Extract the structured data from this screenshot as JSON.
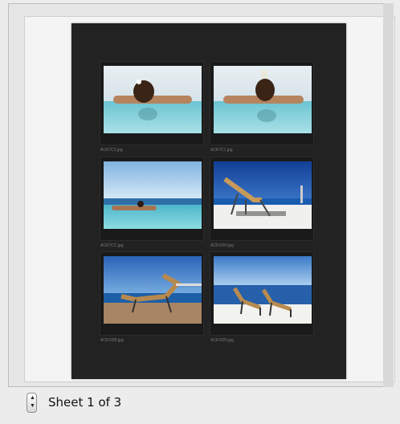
{
  "pager": {
    "label": "Sheet 1 of 3"
  },
  "thumbnails": [
    {
      "filename": "ACK7C2.jpg",
      "subject": "woman-in-infinity-pool"
    },
    {
      "filename": "ACK7C1.jpg",
      "subject": "woman-in-infinity-pool"
    },
    {
      "filename": "ACK7CC.jpg",
      "subject": "woman-floating-in-pool"
    },
    {
      "filename": "ACKXDH.jpg",
      "subject": "lounge-chair-on-deck"
    },
    {
      "filename": "ACKXDB.jpg",
      "subject": "lounge-chair-sea-view"
    },
    {
      "filename": "ACKXDD.jpg",
      "subject": "two-lounge-chairs"
    }
  ],
  "icons": {
    "stepper": "up-down-stepper-icon"
  }
}
